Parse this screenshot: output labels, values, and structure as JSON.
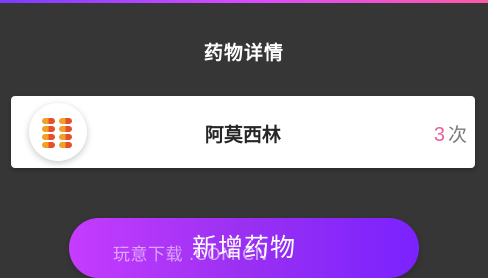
{
  "header": {
    "title": "药物详情"
  },
  "drug": {
    "name": "阿莫西林",
    "count": "3",
    "count_unit": "次",
    "icon": "pill-capsules-icon"
  },
  "actions": {
    "add_label": "新增药物"
  },
  "watermark": {
    "text": "玩意下载    .COM.CN"
  },
  "colors": {
    "background": "#363636",
    "accent_pink": "#ea5f9a",
    "button_gradient_start": "#c53cff",
    "button_gradient_end": "#7a22ff"
  }
}
